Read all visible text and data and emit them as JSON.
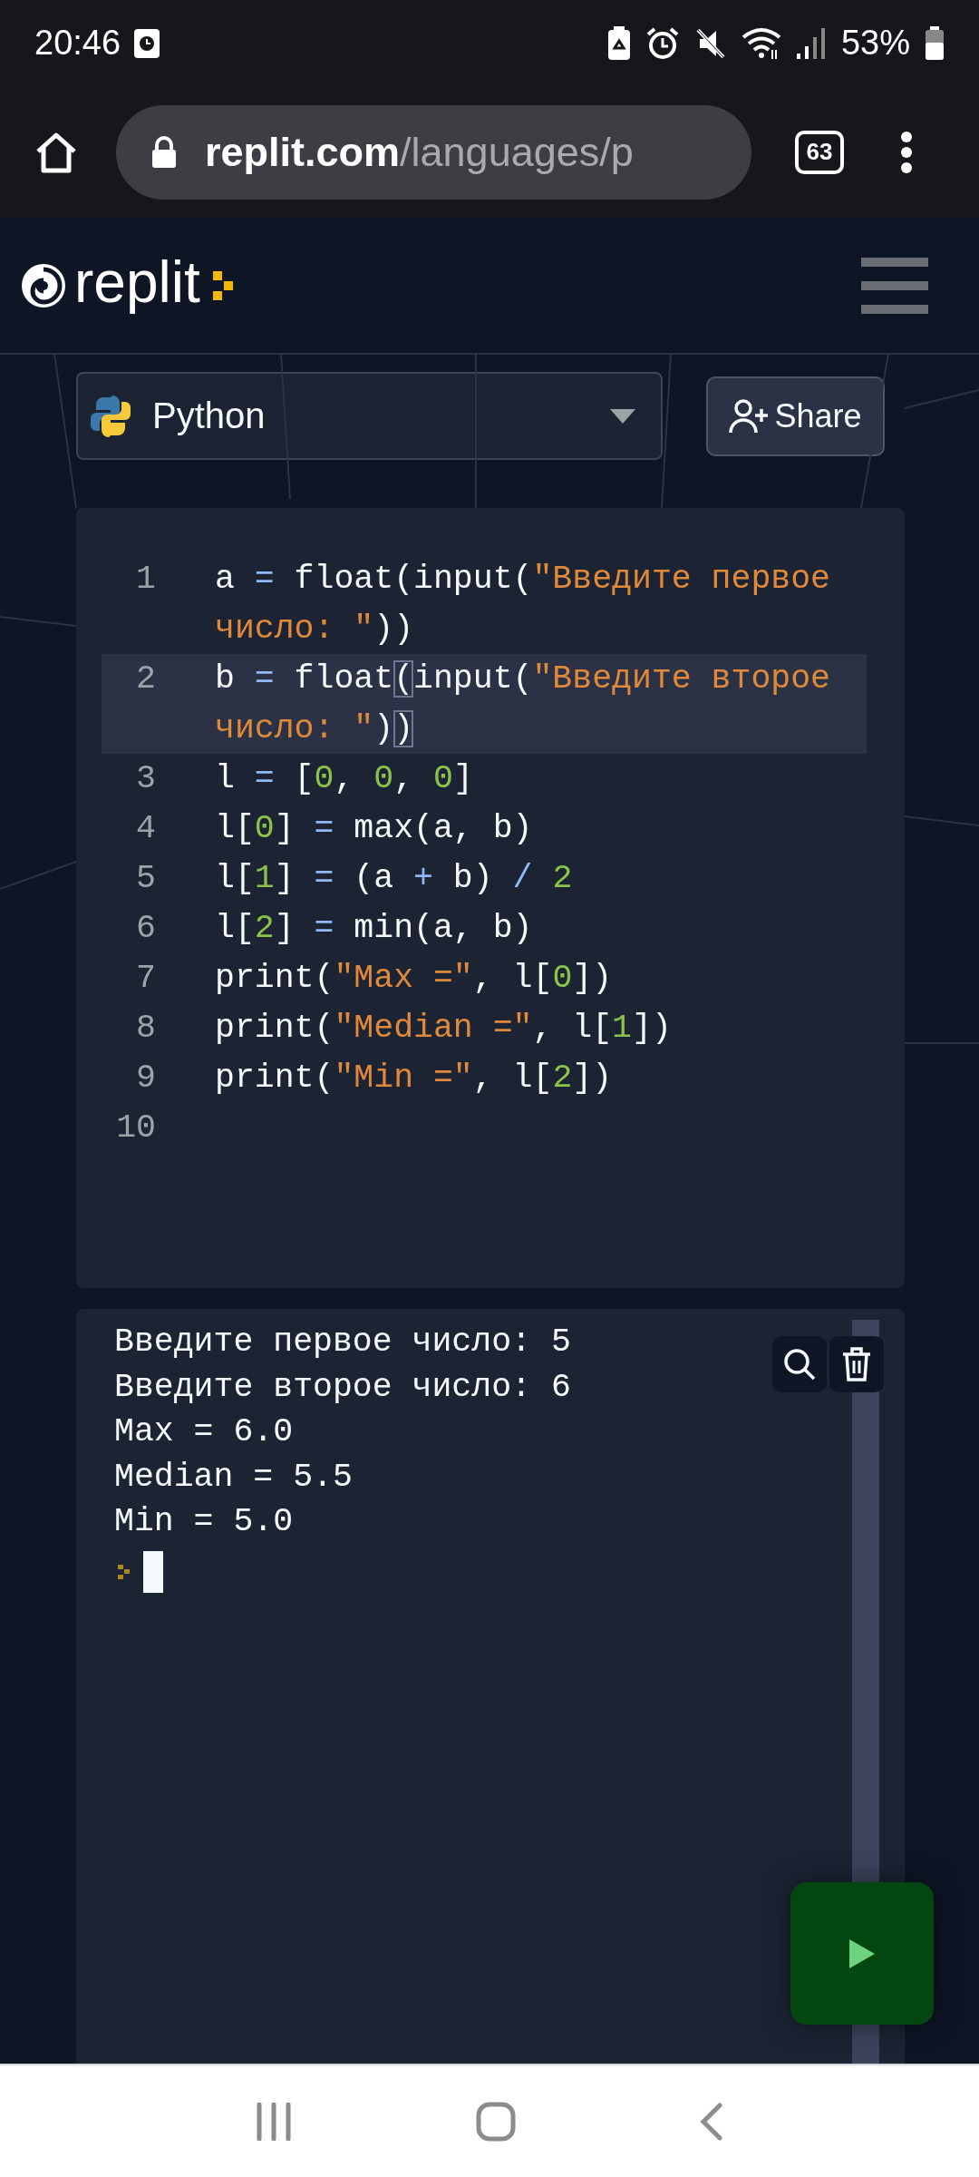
{
  "status_bar": {
    "time": "20:46",
    "battery": "53%"
  },
  "browser": {
    "url_host": "replit.com",
    "url_path": "/languages/p",
    "tab_count": "63"
  },
  "header": {
    "logo_text": "replit"
  },
  "language_select": {
    "value": "Python"
  },
  "share_button": {
    "label": "Share"
  },
  "editor": {
    "lines": [
      {
        "number": "1",
        "highlighted": false,
        "tokens": [
          {
            "kind": "plain",
            "text": "a "
          },
          {
            "kind": "op",
            "text": "="
          },
          {
            "kind": "plain",
            "text": " float(input("
          },
          {
            "kind": "string",
            "text": "\"Введите первое число: \""
          },
          {
            "kind": "plain",
            "text": "))"
          }
        ]
      },
      {
        "number": "2",
        "highlighted": true,
        "tokens": [
          {
            "kind": "plain",
            "text": "b "
          },
          {
            "kind": "op",
            "text": "="
          },
          {
            "kind": "plain",
            "text": " float"
          },
          {
            "kind": "bracket",
            "text": "("
          },
          {
            "kind": "plain",
            "text": "input("
          },
          {
            "kind": "string",
            "text": "\"Введите второе число: \""
          },
          {
            "kind": "plain",
            "text": ")"
          },
          {
            "kind": "bracket",
            "text": ")"
          }
        ]
      },
      {
        "number": "3",
        "highlighted": false,
        "tokens": [
          {
            "kind": "plain",
            "text": "l "
          },
          {
            "kind": "op",
            "text": "="
          },
          {
            "kind": "plain",
            "text": " ["
          },
          {
            "kind": "number",
            "text": "0"
          },
          {
            "kind": "plain",
            "text": ", "
          },
          {
            "kind": "number",
            "text": "0"
          },
          {
            "kind": "plain",
            "text": ", "
          },
          {
            "kind": "number",
            "text": "0"
          },
          {
            "kind": "plain",
            "text": "]"
          }
        ]
      },
      {
        "number": "4",
        "highlighted": false,
        "tokens": [
          {
            "kind": "plain",
            "text": "l["
          },
          {
            "kind": "number",
            "text": "0"
          },
          {
            "kind": "plain",
            "text": "] "
          },
          {
            "kind": "op",
            "text": "="
          },
          {
            "kind": "plain",
            "text": " max(a, b)"
          }
        ]
      },
      {
        "number": "5",
        "highlighted": false,
        "tokens": [
          {
            "kind": "plain",
            "text": "l["
          },
          {
            "kind": "number",
            "text": "1"
          },
          {
            "kind": "plain",
            "text": "] "
          },
          {
            "kind": "op",
            "text": "="
          },
          {
            "kind": "plain",
            "text": " (a "
          },
          {
            "kind": "op",
            "text": "+"
          },
          {
            "kind": "plain",
            "text": " b) "
          },
          {
            "kind": "op",
            "text": "/ "
          },
          {
            "kind": "number",
            "text": "2"
          }
        ]
      },
      {
        "number": "6",
        "highlighted": false,
        "tokens": [
          {
            "kind": "plain",
            "text": "l["
          },
          {
            "kind": "number",
            "text": "2"
          },
          {
            "kind": "plain",
            "text": "] "
          },
          {
            "kind": "op",
            "text": "="
          },
          {
            "kind": "plain",
            "text": " min(a, b)"
          }
        ]
      },
      {
        "number": "7",
        "highlighted": false,
        "tokens": [
          {
            "kind": "plain",
            "text": "print("
          },
          {
            "kind": "string",
            "text": "\"Max =\""
          },
          {
            "kind": "plain",
            "text": ", l["
          },
          {
            "kind": "number",
            "text": "0"
          },
          {
            "kind": "plain",
            "text": "])"
          }
        ]
      },
      {
        "number": "8",
        "highlighted": false,
        "tokens": [
          {
            "kind": "plain",
            "text": "print("
          },
          {
            "kind": "string",
            "text": "\"Median =\""
          },
          {
            "kind": "plain",
            "text": ", l["
          },
          {
            "kind": "number",
            "text": "1"
          },
          {
            "kind": "plain",
            "text": "])"
          }
        ]
      },
      {
        "number": "9",
        "highlighted": false,
        "tokens": [
          {
            "kind": "plain",
            "text": "print("
          },
          {
            "kind": "string",
            "text": "\"Min =\""
          },
          {
            "kind": "plain",
            "text": ", l["
          },
          {
            "kind": "number",
            "text": "2"
          },
          {
            "kind": "plain",
            "text": "])"
          }
        ]
      },
      {
        "number": "10",
        "highlighted": false
      }
    ]
  },
  "console": {
    "lines": [
      "Введите первое число: 5",
      "Введите второе число: 6",
      "Max = 6.0",
      "Median = 5.5",
      "Min = 5.0"
    ]
  }
}
